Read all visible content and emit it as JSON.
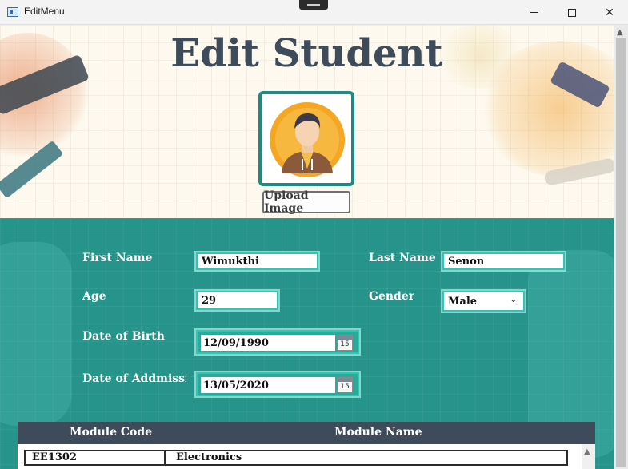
{
  "window": {
    "title": "EditMenu"
  },
  "page": {
    "title": "Edit Student"
  },
  "photo": {
    "upload_label": "Upload Image"
  },
  "form": {
    "first_name_label": "First Name",
    "first_name_value": "Wimukthi",
    "last_name_label": "Last Name",
    "last_name_value": "Senon",
    "age_label": "Age",
    "age_value": "29",
    "gender_label": "Gender",
    "gender_value": "Male",
    "dob_label": "Date of Birth",
    "dob_value": "12/09/1990",
    "admission_label": "Date of Addmission",
    "admission_value": "13/05/2020",
    "calendar_icon_day": "15"
  },
  "modules": {
    "headers": [
      "Module Code",
      "Module Name"
    ],
    "rows": [
      {
        "code": "EE1302",
        "name": "Electronics"
      }
    ]
  },
  "colors": {
    "title": "#3e4b5a",
    "form_background": "#168c82",
    "field_border": "#2fc7b3",
    "table_header": "#3e4b5a"
  },
  "icons": {
    "app": "app-window-icon",
    "minimize": "minimize-icon",
    "maximize": "maximize-icon",
    "close": "close-icon",
    "avatar": "student-avatar-icon",
    "calendar": "calendar-icon",
    "dropdown": "chevron-down-icon"
  }
}
